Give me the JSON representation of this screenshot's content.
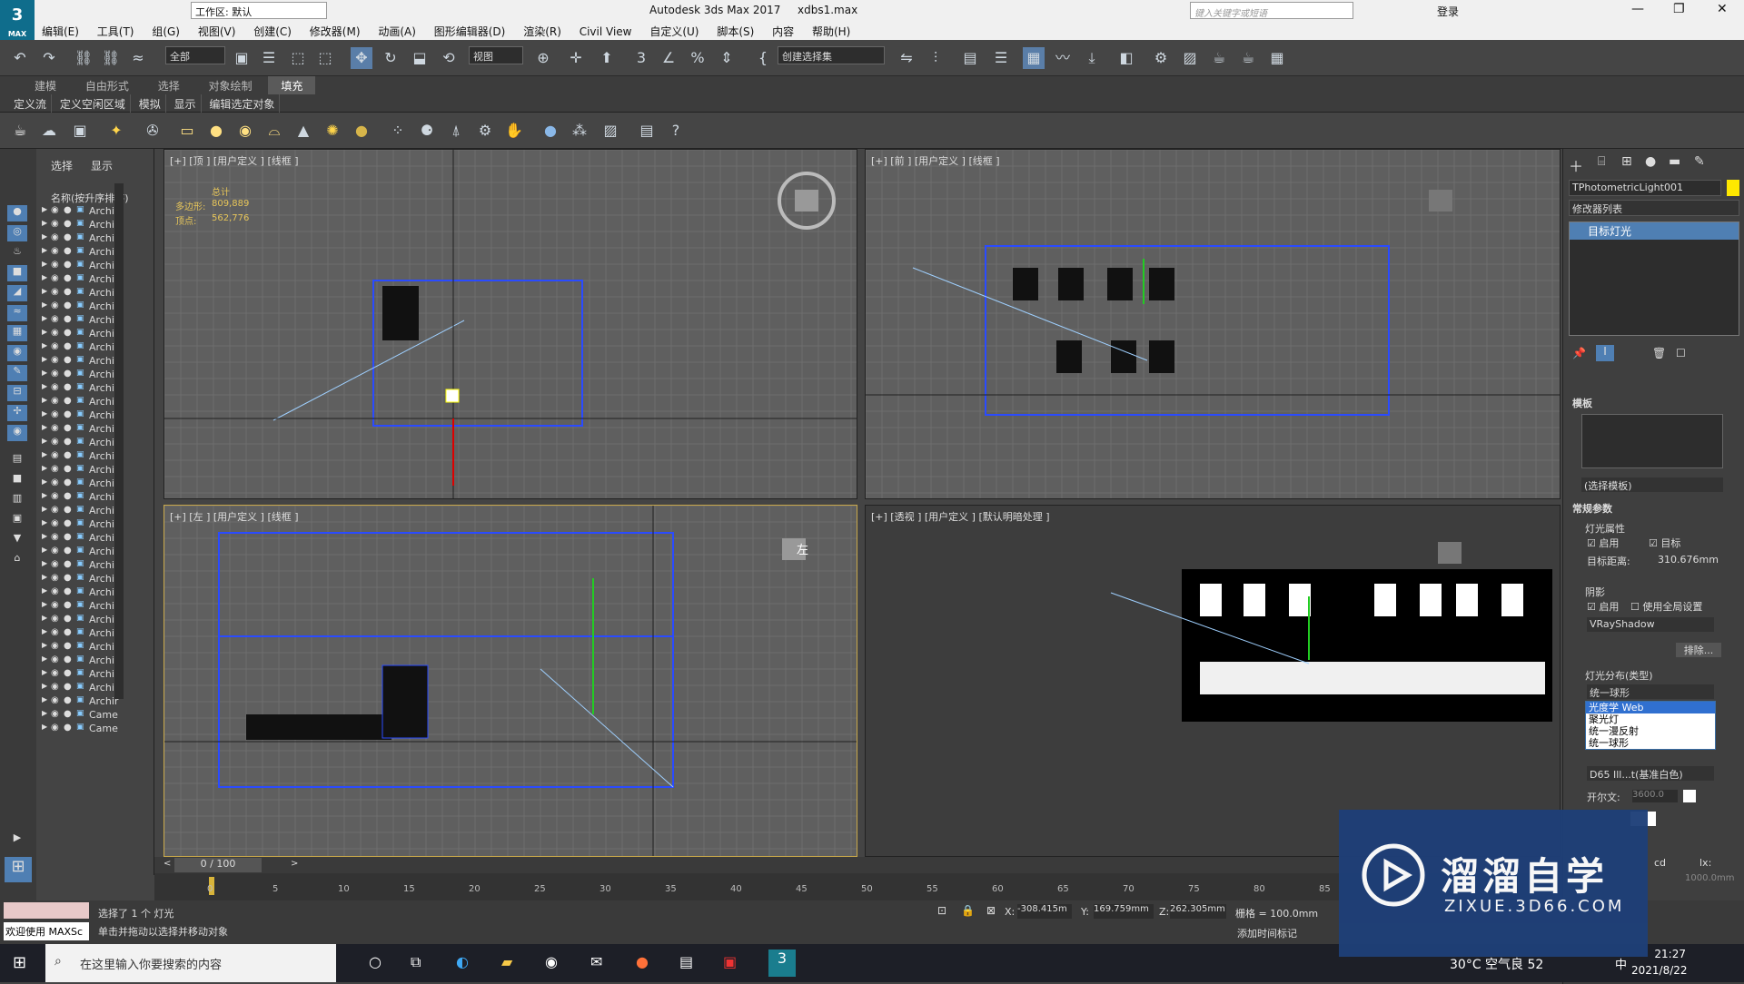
{
  "app": {
    "title": "Autodesk 3ds Max 2017",
    "file": "xdbs1.max",
    "workspace": "工作区: 默认",
    "search_placeholder": "键入关键字或短语",
    "login": "登录",
    "logo": "MAX"
  },
  "menu": [
    "编辑(E)",
    "工具(T)",
    "组(G)",
    "视图(V)",
    "创建(C)",
    "修改器(M)",
    "动画(A)",
    "图形编辑器(D)",
    "渲染(R)",
    "Civil View",
    "自定义(U)",
    "脚本(S)",
    "内容",
    "帮助(H)"
  ],
  "toolbar": {
    "filter": "全部",
    "view": "视图",
    "selection_set": "创建选择集"
  },
  "ribbon_tabs": [
    "建模",
    "自由形式",
    "选择",
    "对象绘制",
    "填充"
  ],
  "ribbon_sub": [
    "定义流",
    "定义空闲区域",
    "模拟",
    "显示",
    "编辑选定对象"
  ],
  "scene": {
    "tabs": [
      "选择",
      "显示"
    ],
    "header": "名称(按升序排序)",
    "rows": [
      "Archir",
      "Archir",
      "Archir",
      "Archir",
      "Archir",
      "Archir",
      "Archir",
      "Archir",
      "Archir",
      "Archir",
      "Archir",
      "Archir",
      "Archir",
      "Archir",
      "Archir",
      "Archir",
      "Archir",
      "Archir",
      "Archir",
      "Archir",
      "Archir",
      "Archir",
      "Archir",
      "Archir",
      "Archir",
      "Archir",
      "Archir",
      "Archir",
      "Archir",
      "Archir",
      "Archir",
      "Archir",
      "Archir",
      "Archir",
      "Archir",
      "Archir",
      "Archir",
      "Came",
      "Came"
    ]
  },
  "viewports": {
    "top": {
      "label": "[+] [顶 ] [用户定义 ] [线框 ]",
      "stats": {
        "total": "总计",
        "poly_label": "多边形:",
        "poly": "809,889",
        "vert_label": "顶点:",
        "vert": "562,776"
      }
    },
    "front": {
      "label": "[+] [前 ] [用户定义 ] [线框 ]"
    },
    "left": {
      "label": "[+] [左 ] [用户定义 ] [线框 ]",
      "cube": "左"
    },
    "persp": {
      "label": "[+] [透视 ] [用户定义 ] [默认明暗处理 ]"
    }
  },
  "right_panel": {
    "object_name": "TPhotometricLight001",
    "modifier_list": "修改器列表",
    "stack_item": "目标灯光",
    "rollout_template": "模板",
    "template_select": "(选择模板)",
    "rollout_general": "常规参数",
    "light_props": "灯光属性",
    "enable": "启用",
    "target": "目标",
    "target_dist_label": "目标距离:",
    "target_dist": "310.676mm",
    "shadows": "阴影",
    "shadow_enable": "启用",
    "global": "使用全局设置",
    "shadow_type": "VRayShadow",
    "exclude": "排除...",
    "dist_label": "灯光分布(类型)",
    "dist_value": "统一球形",
    "dist_options": [
      "光度学 Web",
      "聚光灯",
      "统一漫反射",
      "统一球形"
    ],
    "color_preset": "D65 Ill...t(基准白色)",
    "kelvin_label": "开尔文:",
    "kelvin": "3600.0",
    "cd": "cd",
    "lx": "lx:",
    "lx_val": "1000.0mm"
  },
  "timeline": {
    "frame": "0 / 100",
    "ticks": [
      "0",
      "5",
      "10",
      "15",
      "20",
      "25",
      "30",
      "35",
      "40",
      "45",
      "50",
      "55",
      "60",
      "65",
      "70",
      "75",
      "80",
      "85"
    ]
  },
  "status": {
    "selected": "选择了 1 个 灯光",
    "hint": "单击并拖动以选择并移动对象",
    "welcome": "欢迎使用 MAXSc",
    "x_label": "X:",
    "x": "-308.415m",
    "y_label": "Y:",
    "y": "169.759mm",
    "z_label": "Z:",
    "z": "262.305mm",
    "grid": "栅格 = 100.0mm",
    "add_tag": "添加时间标记"
  },
  "taskbar": {
    "search": "在这里输入你要搜索的内容",
    "weather": "30°C 空气良 52",
    "time": "21:27",
    "date": "2021/8/22",
    "ime": "中"
  },
  "watermark": {
    "title": "溜溜自学",
    "url": "ZIXUE.3D66.COM"
  }
}
